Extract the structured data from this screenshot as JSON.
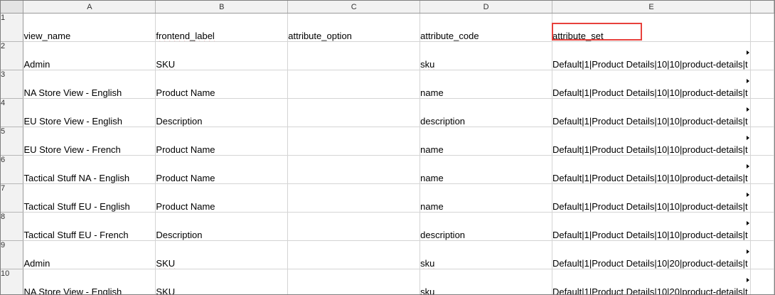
{
  "columns": [
    "A",
    "B",
    "C",
    "D",
    "E"
  ],
  "rows": [
    {
      "num": "1",
      "cells": [
        "view_name",
        "frontend_label",
        "attribute_option",
        "attribute_code",
        "attribute_set"
      ]
    },
    {
      "num": "2",
      "cells": [
        "Admin",
        "SKU",
        "",
        "sku",
        "Default|1|Product Details|10|10|product-details|t"
      ]
    },
    {
      "num": "3",
      "cells": [
        "NA Store View - English",
        "Product Name",
        "",
        "name",
        "Default|1|Product Details|10|10|product-details|t"
      ]
    },
    {
      "num": "4",
      "cells": [
        "EU Store View - English",
        "Description",
        "",
        "description",
        "Default|1|Product Details|10|10|product-details|t"
      ]
    },
    {
      "num": "5",
      "cells": [
        "EU Store View - French",
        "Product Name",
        "",
        "name",
        "Default|1|Product Details|10|10|product-details|t"
      ]
    },
    {
      "num": "6",
      "cells": [
        "Tactical Stuff NA - English",
        "Product Name",
        "",
        "name",
        "Default|1|Product Details|10|10|product-details|t"
      ]
    },
    {
      "num": "7",
      "cells": [
        "Tactical Stuff EU - English",
        "Product Name",
        "",
        "name",
        "Default|1|Product Details|10|10|product-details|t"
      ]
    },
    {
      "num": "8",
      "cells": [
        "Tactical Stuff EU - French",
        "Description",
        "",
        "description",
        "Default|1|Product Details|10|10|product-details|t"
      ]
    },
    {
      "num": "9",
      "cells": [
        "Admin",
        "SKU",
        "",
        "sku",
        "Default|1|Product Details|10|20|product-details|t"
      ]
    },
    {
      "num": "10",
      "cells": [
        "NA Store View - English",
        "SKU",
        "",
        "sku",
        "Default|1|Product Details|10|20|product-details|t"
      ]
    }
  ],
  "highlight": {
    "cell": "E1",
    "color": "#e8413c"
  },
  "colors": {
    "header_bg": "#f2f2f2",
    "gridline": "#d4d4d4",
    "highlight_border": "#e8413c"
  }
}
